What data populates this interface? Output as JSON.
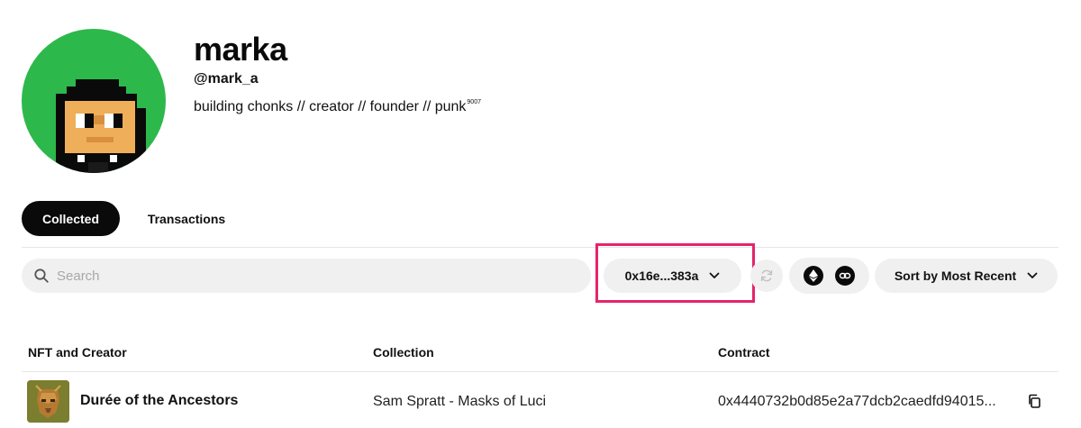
{
  "profile": {
    "name": "marka",
    "handle": "@mark_a",
    "bio": "building chonks // creator // founder // punk",
    "bio_superscript": "9007",
    "avatar_bg_color": "#2db84b"
  },
  "tabs": [
    {
      "label": "Collected",
      "active": true
    },
    {
      "label": "Transactions",
      "active": false
    }
  ],
  "toolbar": {
    "search_placeholder": "Search",
    "wallet_address": "0x16e...383a",
    "sort_label": "Sort by Most Recent",
    "chain_icons": [
      "ethereum-icon",
      "chainlink-icon"
    ],
    "highlight_color": "#e5246a"
  },
  "table": {
    "columns": [
      "NFT and Creator",
      "Collection",
      "Contract"
    ],
    "rows": [
      {
        "nft_name": "Durée of the Ancestors",
        "collection": "Sam Spratt - Masks of Luci",
        "contract": "0x4440732b0d85e2a77dcb2caedfd94015..."
      }
    ]
  }
}
